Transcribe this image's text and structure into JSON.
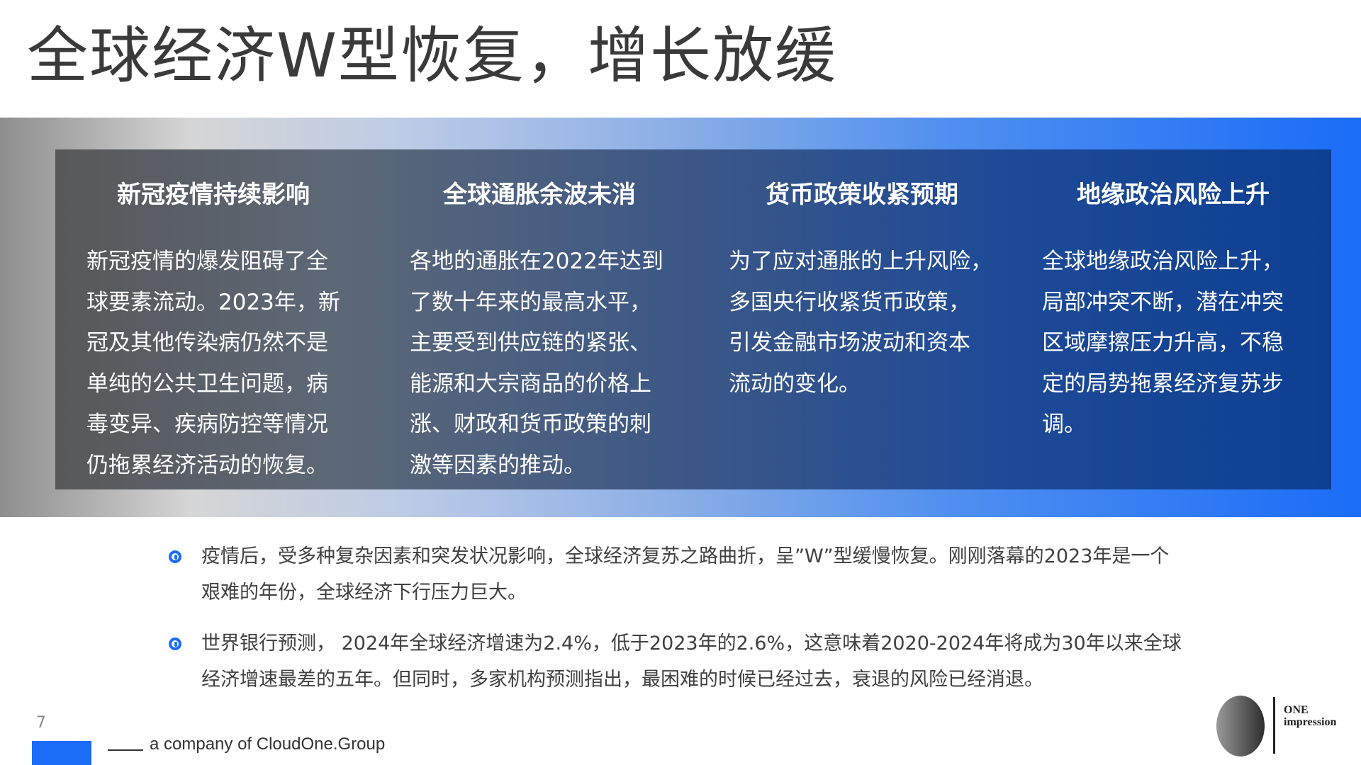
{
  "title": "全球经济W型恢复，增长放缓",
  "columns": [
    {
      "heading": "新冠疫情持续影响",
      "lines": [
        "新冠疫情的爆发阻碍了全",
        "球要素流动。2023年，新",
        "冠及其他传染病仍然不是",
        "单纯的公共卫生问题，病",
        "毒变异、疾病防控等情况",
        "仍拖累经济活动的恢复。"
      ]
    },
    {
      "heading": "全球通胀余波未消",
      "lines": [
        "各地的通胀在2022年达到",
        "了数十年来的最高水平，",
        "主要受到供应链的紧张、",
        "能源和大宗商品的价格上",
        "涨、财政和货币政策的刺",
        "激等因素的推动。"
      ]
    },
    {
      "heading": "货币政策收紧预期",
      "lines": [
        "为了应对通胀的上升风险，",
        "多国央行收紧货币政策，",
        "引发金融市场波动和资本",
        "流动的变化。"
      ]
    },
    {
      "heading": "地缘政治风险上升",
      "lines": [
        "全球地缘政治风险上升，",
        "局部冲突不断，潜在冲突",
        "区域摩擦压力升高，不稳",
        "定的局势拖累经济复苏步",
        "调。"
      ]
    }
  ],
  "bullets": [
    {
      "lines": [
        "疫情后，受多种复杂因素和突发状况影响，全球经济复苏之路曲折，呈”W”型缓慢恢复。刚刚落幕的2023年是一个",
        "艰难的年份，全球经济下行压力巨大。"
      ]
    },
    {
      "lines": [
        "世界银行预测， 2024年全球经济增速为2.4%，低于2023年的2.6%，这意味着2020-2024年将成为30年以来全球",
        "经济增速最差的五年。但同时，多家机构预测指出，最困难的时候已经过去，衰退的风险已经消退。"
      ]
    }
  ],
  "footer": {
    "page_number": "7",
    "company": "a company of CloudOne.Group"
  },
  "logo": {
    "line1": "ONE",
    "line2": "impression"
  },
  "colors": {
    "accent": "#1b6cf7",
    "panel_dark": "#585858",
    "panel_blue": "#0e3f92"
  }
}
